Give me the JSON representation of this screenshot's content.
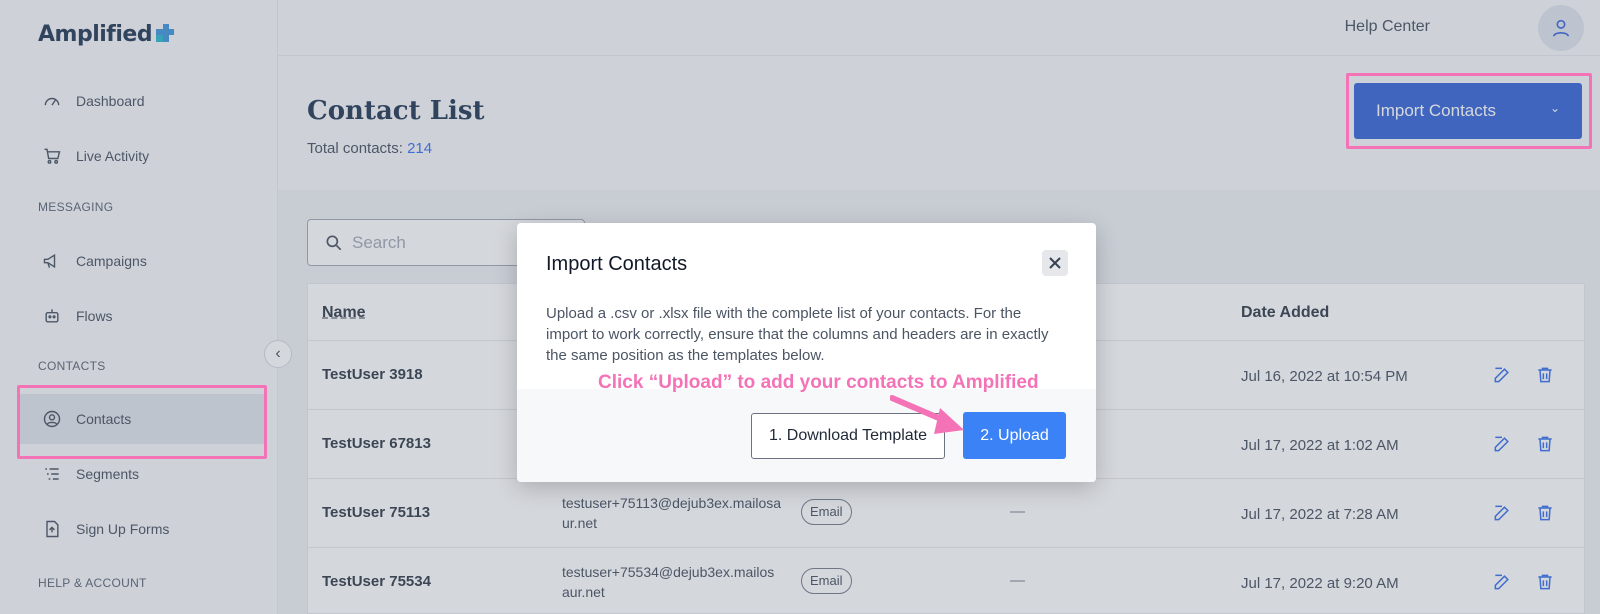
{
  "brand": {
    "name": "Amplified"
  },
  "sidebar": {
    "items": [
      {
        "label": "Dashboard",
        "icon": "gauge-icon"
      },
      {
        "label": "Live Activity",
        "icon": "cart-icon"
      },
      {
        "label": "Campaigns",
        "icon": "megaphone-icon"
      },
      {
        "label": "Flows",
        "icon": "robot-icon"
      },
      {
        "label": "Contacts",
        "icon": "user-circle-icon"
      },
      {
        "label": "Segments",
        "icon": "list-icon"
      },
      {
        "label": "Sign Up Forms",
        "icon": "form-icon"
      }
    ],
    "sections": [
      "MESSAGING",
      "CONTACTS",
      "HELP & ACCOUNT"
    ]
  },
  "header": {
    "help": "Help Center"
  },
  "page": {
    "title": "Contact List",
    "total_label": "Total contacts:",
    "total_count": "214",
    "import_button": "Import Contacts",
    "search_placeholder": "Search"
  },
  "table": {
    "headers": {
      "name": "Name",
      "date": "Date Added"
    },
    "rows": [
      {
        "name": "TestUser 3918",
        "email": "",
        "tag": "",
        "date": "Jul 16, 2022 at 10:54 PM"
      },
      {
        "name": "TestUser 67813",
        "email": "",
        "tag": "",
        "date": "Jul 17, 2022 at 1:02 AM"
      },
      {
        "name": "TestUser 75113",
        "email": "testuser+75113@dejub3ex.mailosaur.net",
        "tag": "Email",
        "dash": "—",
        "date": "Jul 17, 2022 at 7:28 AM"
      },
      {
        "name": "TestUser 75534",
        "email": "testuser+75534@dejub3ex.mailosaur.net",
        "tag": "Email",
        "dash": "—",
        "date": "Jul 17, 2022 at 9:20 AM"
      }
    ]
  },
  "modal": {
    "title": "Import Contacts",
    "body": "Upload a .csv or .xlsx file with the complete list of your contacts. For the import to work correctly, ensure that the columns and headers are in exactly the same position as the templates below.",
    "download_button": "1. Download Template",
    "upload_button": "2. Upload"
  },
  "annotation": "Click “Upload” to add your contacts to Amplified",
  "colors": {
    "primary": "#2657d4",
    "accent": "#3b82f6",
    "highlight": "#f472b6",
    "brand": "#0f2746"
  }
}
